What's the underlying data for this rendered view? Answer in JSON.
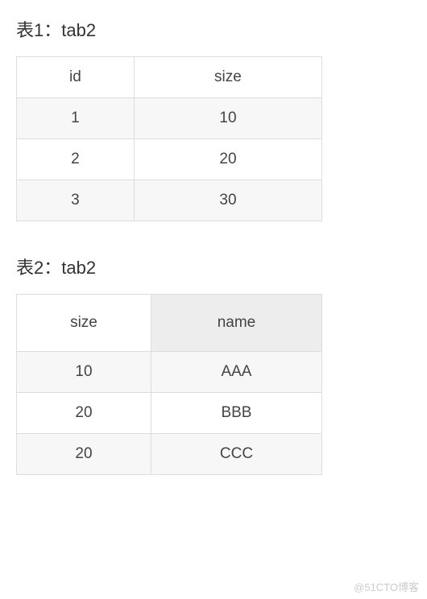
{
  "section1": {
    "heading": "表1：tab2",
    "table": {
      "headers": [
        "id",
        "size"
      ],
      "rows": [
        [
          "1",
          "10"
        ],
        [
          "2",
          "20"
        ],
        [
          "3",
          "30"
        ]
      ]
    }
  },
  "section2": {
    "heading": "表2：tab2",
    "table": {
      "headers": [
        "size",
        "name"
      ],
      "rows": [
        [
          "10",
          "AAA"
        ],
        [
          "20",
          "BBB"
        ],
        [
          "20",
          "CCC"
        ]
      ]
    }
  },
  "watermark": "@51CTO博客",
  "chart_data": [
    {
      "type": "table",
      "title": "表1：tab2",
      "columns": [
        "id",
        "size"
      ],
      "rows": [
        {
          "id": 1,
          "size": 10
        },
        {
          "id": 2,
          "size": 20
        },
        {
          "id": 3,
          "size": 30
        }
      ]
    },
    {
      "type": "table",
      "title": "表2：tab2",
      "columns": [
        "size",
        "name"
      ],
      "rows": [
        {
          "size": 10,
          "name": "AAA"
        },
        {
          "size": 20,
          "name": "BBB"
        },
        {
          "size": 20,
          "name": "CCC"
        }
      ]
    }
  ]
}
